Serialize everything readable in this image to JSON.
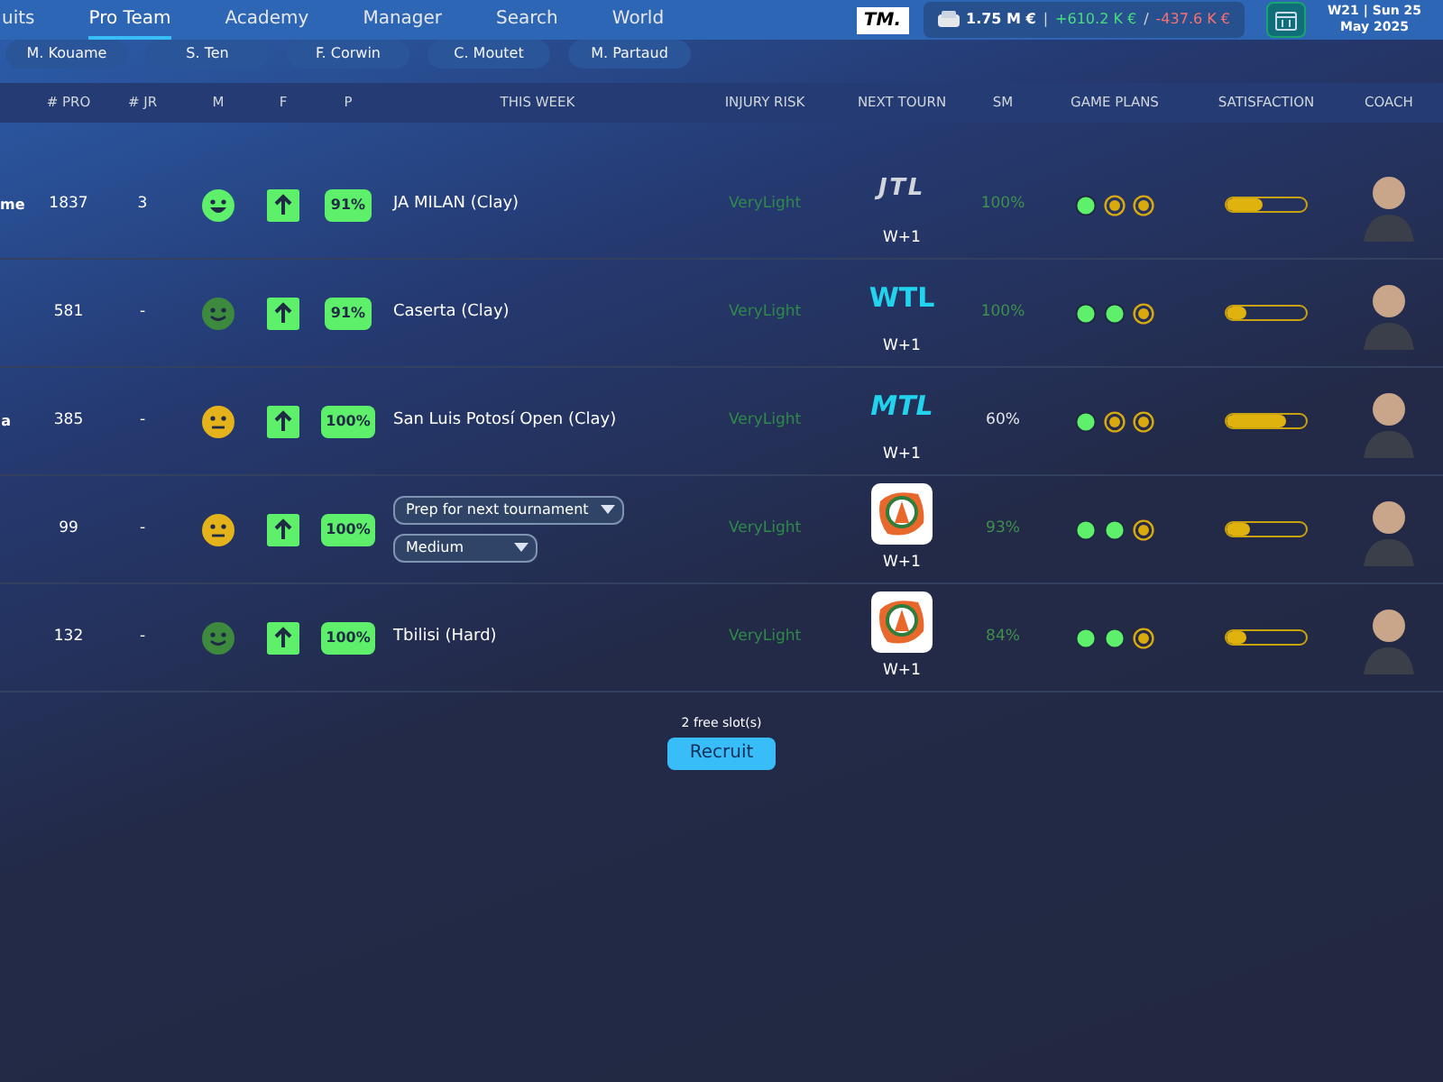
{
  "nav": {
    "tabs": [
      {
        "label": "uits",
        "selected": false
      },
      {
        "label": "Pro Team",
        "selected": true
      },
      {
        "label": "Academy",
        "selected": false
      },
      {
        "label": "Manager",
        "selected": false
      },
      {
        "label": "Search",
        "selected": false
      },
      {
        "label": "World",
        "selected": false
      }
    ],
    "logo": "TM.",
    "finance": {
      "balance": "1.75 M €",
      "sep": "|",
      "income": "+610.2 K €",
      "slash": "/",
      "expense": "-437.6 K €"
    },
    "date": {
      "week": "W21 | Sun 25",
      "month": "May 2025"
    }
  },
  "players": [
    {
      "label": "M. Kouame"
    },
    {
      "label": "S. Ten"
    },
    {
      "label": "F. Corwin"
    },
    {
      "label": "C. Moutet"
    },
    {
      "label": "M. Partaud"
    }
  ],
  "table": {
    "columns": [
      "# PRO",
      "# JR",
      "M",
      "F",
      "P",
      "THIS WEEK",
      "INJURY RISK",
      "NEXT TOURN",
      "SM",
      "GAME PLANS",
      "SATISFACTION",
      "COACH"
    ],
    "rows": [
      {
        "column_1": "me",
        "pro": "1837",
        "jr": "3",
        "mood": {
          "kind": "grin"
        },
        "form": {
          "kind": "up"
        },
        "p": "91%",
        "week": {
          "kind": "text",
          "text": "JA MILAN (Clay)"
        },
        "injury": "VeryLight",
        "tourn": {
          "kind": "jtl",
          "logo_text": "JTL",
          "when": "W+1"
        },
        "sm": {
          "text": "100%",
          "color": "#3f8f4f"
        },
        "plans": [
          {
            "on": true
          },
          {
            "on": false
          },
          {
            "on": false
          }
        ],
        "satisfaction": {
          "level": 0.45
        }
      },
      {
        "column_1": "",
        "pro": "581",
        "jr": "-",
        "mood": {
          "kind": "smile"
        },
        "form": {
          "kind": "up"
        },
        "p": "91%",
        "week": {
          "kind": "text",
          "text": "Caserta (Clay)"
        },
        "injury": "VeryLight",
        "tourn": {
          "kind": "wtl",
          "logo_text": "WTL",
          "when": "W+1"
        },
        "sm": {
          "text": "100%",
          "color": "#3f8f4f"
        },
        "plans": [
          {
            "on": true
          },
          {
            "on": true
          },
          {
            "on": false
          }
        ],
        "satisfaction": {
          "level": 0.25
        }
      },
      {
        "column_1": "a",
        "pro": "385",
        "jr": "-",
        "mood": {
          "kind": "neutral"
        },
        "form": {
          "kind": "up"
        },
        "p": "100%",
        "week": {
          "kind": "text",
          "text": "San Luis Potosí Open (Clay)"
        },
        "injury": "VeryLight",
        "tourn": {
          "kind": "mtl",
          "logo_text": "MTL",
          "when": "W+1"
        },
        "sm": {
          "text": "60%",
          "color": "#e5e7eb"
        },
        "plans": [
          {
            "on": true
          },
          {
            "on": false
          },
          {
            "on": false
          }
        ],
        "satisfaction": {
          "level": 0.75
        }
      },
      {
        "column_1": "",
        "pro": "99",
        "jr": "-",
        "mood": {
          "kind": "neutral"
        },
        "form": {
          "kind": "up"
        },
        "p": "100%",
        "week": {
          "kind": "dropdowns",
          "selects": [
            "Prep for next tournament",
            "Medium"
          ]
        },
        "injury": "VeryLight",
        "tourn": {
          "kind": "badge",
          "when": "W+1"
        },
        "sm": {
          "text": "93%",
          "color": "#3f8f4f"
        },
        "plans": [
          {
            "on": true
          },
          {
            "on": true
          },
          {
            "on": false
          }
        ],
        "satisfaction": {
          "level": 0.3
        }
      },
      {
        "column_1": "",
        "pro": "132",
        "jr": "-",
        "mood": {
          "kind": "smile"
        },
        "form": {
          "kind": "up"
        },
        "p": "100%",
        "week": {
          "kind": "text",
          "text": "Tbilisi (Hard)"
        },
        "injury": "VeryLight",
        "tourn": {
          "kind": "badge",
          "when": "W+1"
        },
        "sm": {
          "text": "84%",
          "color": "#3f8f4f"
        },
        "plans": [
          {
            "on": true
          },
          {
            "on": true
          },
          {
            "on": false
          }
        ],
        "satisfaction": {
          "level": 0.25
        }
      }
    ]
  },
  "footer": {
    "slots": "2 free slot(s)",
    "button": "Recruit"
  }
}
